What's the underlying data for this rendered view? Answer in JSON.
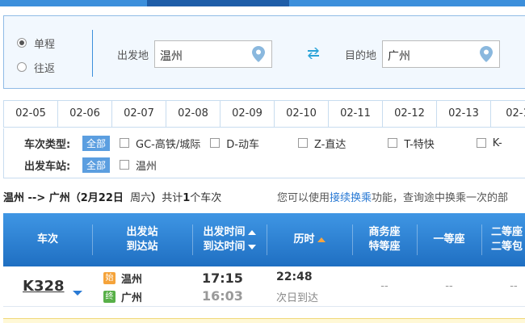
{
  "trip_type": {
    "one_way": "单程",
    "round_trip": "往返"
  },
  "from": {
    "label": "出发地",
    "value": "温州"
  },
  "to": {
    "label": "目的地",
    "value": "广州"
  },
  "dates": [
    "02-05",
    "02-06",
    "02-07",
    "02-08",
    "02-09",
    "02-10",
    "02-11",
    "02-12",
    "02-13",
    "02-1"
  ],
  "filters": {
    "type_label": "车次类型:",
    "type_all": "全部",
    "types": [
      "GC-高铁/城际",
      "D-动车",
      "Z-直达",
      "T-特快",
      "K-"
    ],
    "station_label": "出发车站:",
    "station_all": "全部",
    "stations": [
      "温州"
    ]
  },
  "summary": {
    "route": "温州 --> 广州（",
    "date": "2月22日",
    "weekday": "周六",
    "close": "）",
    "count_prefix": "共计",
    "count": "1",
    "count_suffix": "个车次",
    "hint_prefix": "您可以使用",
    "hint_link": "接续换乘",
    "hint_suffix": "功能，查询途中换乘一次的部"
  },
  "table": {
    "headers": {
      "train": "车次",
      "stations_1": "出发站",
      "stations_2": "到达站",
      "times_1": "出发时间",
      "times_2": "到达时间",
      "duration": "历时",
      "business_1": "商务座",
      "business_2": "特等座",
      "first": "一等座",
      "second_1": "二等座",
      "second_2": "二等包"
    },
    "rows": [
      {
        "train_no": "K328",
        "start_badge": "始",
        "from": "温州",
        "end_badge": "终",
        "to": "广州",
        "depart": "17:15",
        "arrive": "16:03",
        "duration": "22:48",
        "duration_note": "次日到达",
        "business": "--",
        "first": "--",
        "second": "--"
      }
    ]
  },
  "colors": {
    "accent": "#3c8fdb",
    "header": "#2a7ad4",
    "start_badge": "#f5a33a",
    "end_badge": "#58b048"
  }
}
